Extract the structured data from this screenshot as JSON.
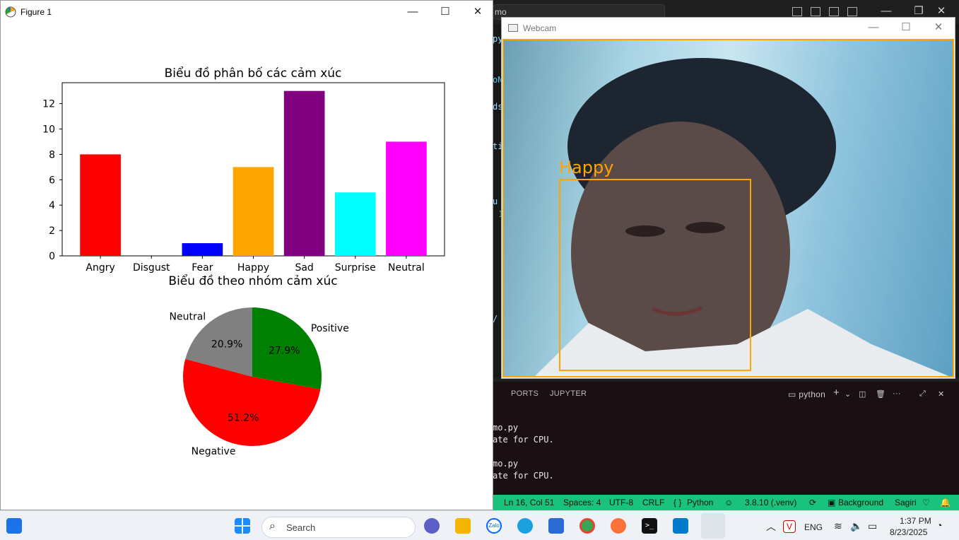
{
  "vscode": {
    "cmd_text": "mo",
    "editor_fragments": [
      "py",
      "oN",
      "ds",
      "ti",
      "u",
      "1",
      "/"
    ],
    "panel_tabs": [
      "PORTS",
      "JUPYTER"
    ],
    "terminal_name": "python",
    "terminal_lines": [
      "mo.py",
      "ate for CPU.",
      "mo.py",
      "ate for CPU."
    ],
    "status": {
      "position": "Ln 16, Col 51",
      "spaces": "Spaces: 4",
      "encoding": "UTF-8",
      "eol": "CRLF",
      "language": "Python",
      "interpreter": "3.8.10 (.venv)",
      "background": "Background",
      "user": "Sagiri"
    }
  },
  "figure_window": {
    "title": "Figure 1",
    "minimize": "—",
    "maximize": "☐",
    "close": "✕"
  },
  "chart_data": [
    {
      "type": "bar",
      "title": "Biểu đồ phân bố các cảm xúc",
      "categories": [
        "Angry",
        "Disgust",
        "Fear",
        "Happy",
        "Sad",
        "Surprise",
        "Neutral"
      ],
      "values": [
        8,
        0,
        1,
        7,
        13,
        5,
        9
      ],
      "colors": [
        "#ff0000",
        "#008000",
        "#0000ff",
        "#ffa500",
        "#800080",
        "#00ffff",
        "#ff00ff"
      ],
      "ylim": [
        0,
        13.65
      ],
      "yticks": [
        0,
        2,
        4,
        6,
        8,
        10,
        12
      ],
      "xlabel": "",
      "ylabel": "",
      "grid": false
    },
    {
      "type": "pie",
      "title": "Biểu đồ theo nhóm cảm xúc",
      "labels": [
        "Neutral",
        "Negative",
        "Positive"
      ],
      "values": [
        20.9,
        51.2,
        27.9
      ],
      "pct_labels": [
        "20.9%",
        "51.2%",
        "27.9%"
      ],
      "colors": [
        "#808080",
        "#ff0000",
        "#008000"
      ],
      "start_angle_deg": 90
    }
  ],
  "webcam_window": {
    "title": "Webcam",
    "detection_label": "Happy",
    "box_color": "#ffa500"
  },
  "taskbar": {
    "search_placeholder": "Search",
    "language": "ENG",
    "time": "1:37 PM",
    "date": "8/23/2025",
    "apps": [
      "widgets-icon",
      "start-icon",
      "meet-icon",
      "file-explorer-icon",
      "zalo-icon",
      "edge-icon",
      "store-icon",
      "chrome-icon",
      "firefox-icon",
      "terminal-icon",
      "vscode-icon",
      "matplotlib-icon"
    ],
    "zalo_text": "Zalo"
  }
}
